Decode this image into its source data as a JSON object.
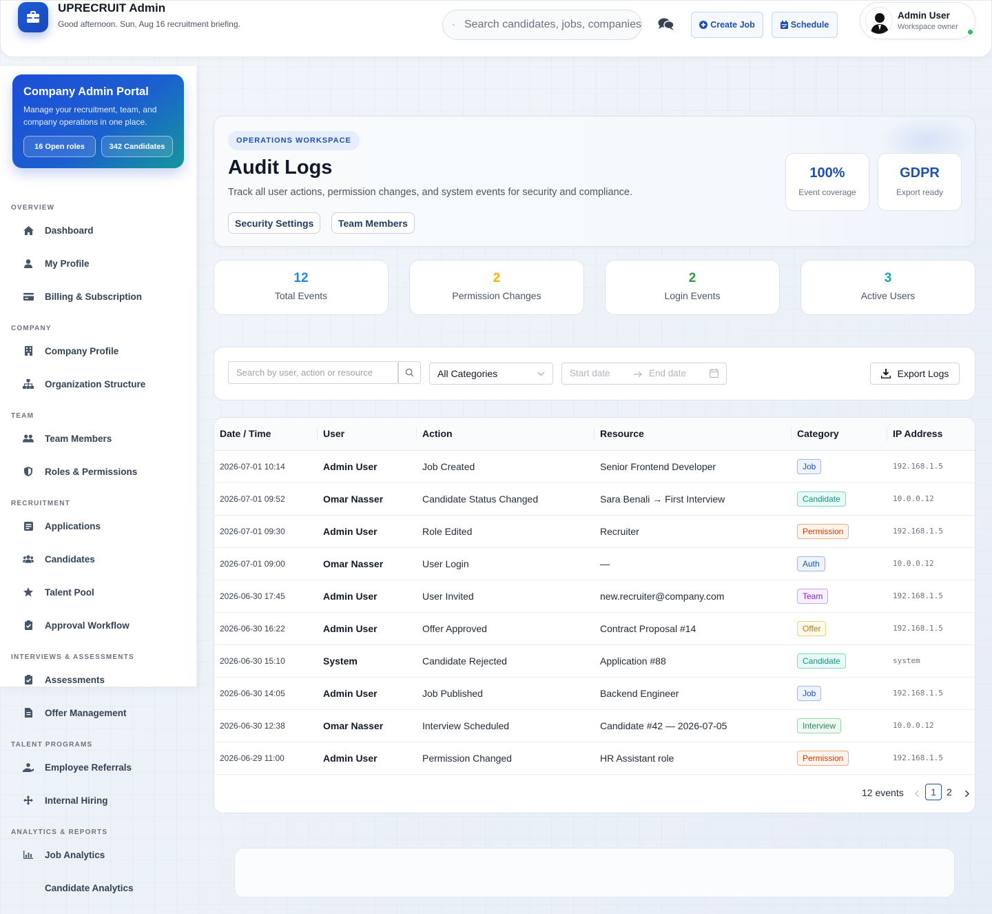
{
  "header": {
    "app_title": "UPRECRUIT Admin",
    "greeting": "Good afternoon. Sun, Aug 16 recruitment briefing.",
    "search_placeholder": "Search candidates, jobs, companies",
    "create_job": "Create Job",
    "schedule": "Schedule",
    "user_name": "Admin User",
    "user_role": "Workspace owner"
  },
  "portal": {
    "title": "Company Admin Portal",
    "desc": "Manage your recruitment, team, and company operations in one place.",
    "open_roles": "16 Open roles",
    "candidates": "342 Candidates"
  },
  "sidebar": {
    "sections": [
      "OVERVIEW",
      "COMPANY",
      "TEAM",
      "RECRUITMENT",
      "INTERVIEWS & ASSESSMENTS",
      "TALENT PROGRAMS",
      "ANALYTICS & REPORTS"
    ],
    "items": [
      {
        "label": "Dashboard",
        "icon": "home-icon"
      },
      {
        "label": "My Profile",
        "icon": "user-icon"
      },
      {
        "label": "Billing & Subscription",
        "icon": "credit-card-icon"
      },
      {
        "label": "Company Profile",
        "icon": "building-icon"
      },
      {
        "label": "Organization Structure",
        "icon": "sitemap-icon"
      },
      {
        "label": "Team Members",
        "icon": "users-icon"
      },
      {
        "label": "Roles & Permissions",
        "icon": "shield-icon"
      },
      {
        "label": "Applications",
        "icon": "inbox-icon"
      },
      {
        "label": "Candidates",
        "icon": "users-group-icon"
      },
      {
        "label": "Talent Pool",
        "icon": "star-icon"
      },
      {
        "label": "Approval Workflow",
        "icon": "clipboard-check-icon"
      },
      {
        "label": "Assessments",
        "icon": "clipboard-check-icon"
      },
      {
        "label": "Offer Management",
        "icon": "file-icon"
      },
      {
        "label": "Employee Referrals",
        "icon": "user-hand-icon"
      },
      {
        "label": "Internal Hiring",
        "icon": "arrows-icon"
      },
      {
        "label": "Job Analytics",
        "icon": "chart-icon"
      },
      {
        "label": "Candidate Analytics",
        "icon": "none"
      }
    ]
  },
  "hero": {
    "badge": "OPERATIONS WORKSPACE",
    "title": "Audit Logs",
    "desc": "Track all user actions, permission changes, and system events for security and compliance.",
    "chip1": "Security Settings",
    "chip2": "Team Members",
    "stat1_value": "100%",
    "stat1_label": "Event coverage",
    "stat2_value": "GDPR",
    "stat2_label": "Export ready"
  },
  "kpis": [
    {
      "value": "12",
      "label": "Total Events",
      "color": "#1e88e5"
    },
    {
      "value": "2",
      "label": "Permission Changes",
      "color": "#f5b400"
    },
    {
      "value": "2",
      "label": "Login Events",
      "color": "#2e9d48"
    },
    {
      "value": "3",
      "label": "Active Users",
      "color": "#1aa3a3"
    }
  ],
  "filters": {
    "search_placeholder": "Search by user, action or resource",
    "category": "All Categories",
    "start_placeholder": "Start date",
    "end_placeholder": "End date",
    "export": "Export Logs"
  },
  "table": {
    "headers": [
      "Date / Time",
      "User",
      "Action",
      "Resource",
      "Category",
      "IP Address"
    ],
    "rows": [
      {
        "dt": "2026-07-01 10:14",
        "user": "Admin User",
        "action": "Job Created",
        "resource": "Senior Frontend Developer",
        "cat": "Job",
        "ip": "192.168.1.5"
      },
      {
        "dt": "2026-07-01 09:52",
        "user": "Omar Nasser",
        "action": "Candidate Status Changed",
        "resource": "Sara Benali → First Interview",
        "cat": "Candidate",
        "ip": "10.0.0.12"
      },
      {
        "dt": "2026-07-01 09:30",
        "user": "Admin User",
        "action": "Role Edited",
        "resource": "Recruiter",
        "cat": "Permission",
        "ip": "192.168.1.5"
      },
      {
        "dt": "2026-07-01 09:00",
        "user": "Omar Nasser",
        "action": "User Login",
        "resource": "—",
        "cat": "Auth",
        "ip": "10.0.0.12"
      },
      {
        "dt": "2026-06-30 17:45",
        "user": "Admin User",
        "action": "User Invited",
        "resource": "new.recruiter@company.com",
        "cat": "Team",
        "ip": "192.168.1.5"
      },
      {
        "dt": "2026-06-30 16:22",
        "user": "Admin User",
        "action": "Offer Approved",
        "resource": "Contract Proposal #14",
        "cat": "Offer",
        "ip": "192.168.1.5"
      },
      {
        "dt": "2026-06-30 15:10",
        "user": "System",
        "action": "Candidate Rejected",
        "resource": "Application #88",
        "cat": "Candidate",
        "ip": "system"
      },
      {
        "dt": "2026-06-30 14:05",
        "user": "Admin User",
        "action": "Job Published",
        "resource": "Backend Engineer",
        "cat": "Job",
        "ip": "192.168.1.5"
      },
      {
        "dt": "2026-06-30 12:38",
        "user": "Omar Nasser",
        "action": "Interview Scheduled",
        "resource": "Candidate #42 — 2026-07-05",
        "cat": "Interview",
        "ip": "10.0.0.12"
      },
      {
        "dt": "2026-06-29 11:00",
        "user": "Admin User",
        "action": "Permission Changed",
        "resource": "HR Assistant role",
        "cat": "Permission",
        "ip": "192.168.1.5"
      }
    ]
  },
  "tag_colors": {
    "Job": {
      "fg": "#1e4fb3",
      "bg": "#eef4ff",
      "bd": "#9db6ec"
    },
    "Candidate": {
      "fg": "#0f9488",
      "bg": "#e8faf6",
      "bd": "#7ed8c8"
    },
    "Permission": {
      "fg": "#c2410c",
      "bg": "#fff4ec",
      "bd": "#f3a97a"
    },
    "Auth": {
      "fg": "#1e4fb3",
      "bg": "#eef4ff",
      "bd": "#9db6ec"
    },
    "Team": {
      "fg": "#7e22ce",
      "bg": "#f8f0ff",
      "bd": "#c9a3ef"
    },
    "Offer": {
      "fg": "#b7791f",
      "bg": "#fffbea",
      "bd": "#f1d27a"
    },
    "Interview": {
      "fg": "#2f855a",
      "bg": "#effcf1",
      "bd": "#9bd6a8"
    }
  },
  "pager": {
    "count": "12 events",
    "current": "1",
    "next_page": "2"
  }
}
